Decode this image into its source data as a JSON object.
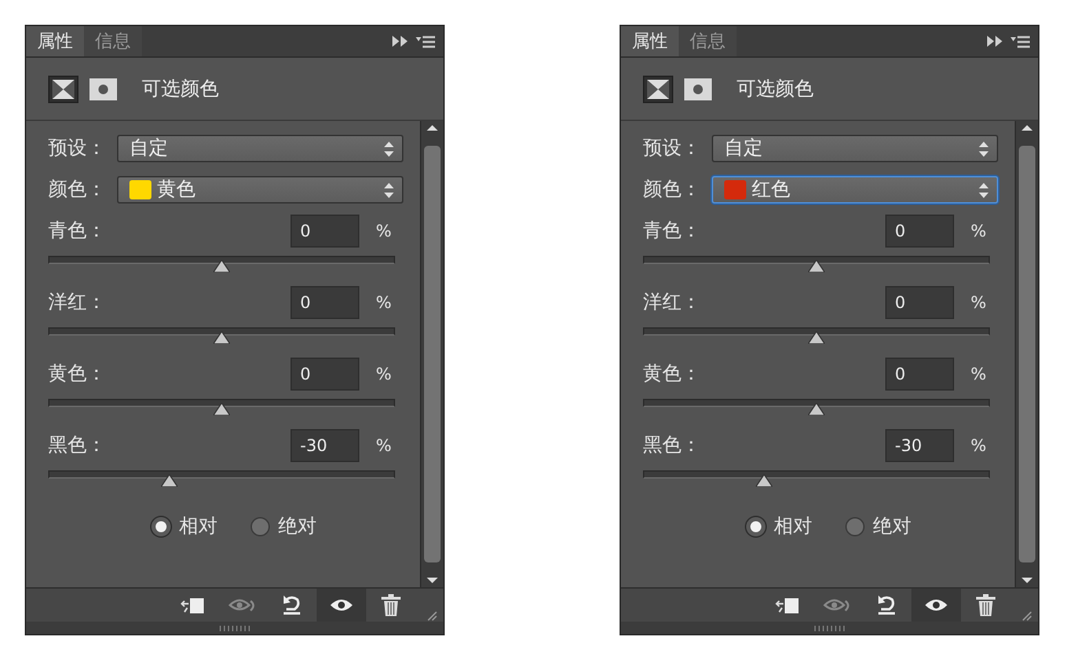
{
  "panels": [
    {
      "tabs": [
        {
          "label": "属性",
          "selected": true
        },
        {
          "label": "信息",
          "selected": false
        }
      ],
      "title": "可选颜色",
      "preset": {
        "label": "预设：",
        "value": "自定"
      },
      "color_field": {
        "label": "颜色：",
        "value": "黄色",
        "color": "#ffd800",
        "focused": false
      },
      "sliders": [
        {
          "name": "青色：",
          "value": "0",
          "unit": "%",
          "level": 0.5
        },
        {
          "name": "洋红：",
          "value": "0",
          "unit": "%",
          "level": 0.5
        },
        {
          "name": "黄色：",
          "value": "0",
          "unit": "%",
          "level": 0.5
        },
        {
          "name": "黑色：",
          "value": "-30",
          "unit": "%",
          "level": 0.35
        }
      ],
      "radios": [
        {
          "label": "相对",
          "selected": true
        },
        {
          "label": "绝对",
          "selected": false
        }
      ],
      "visibility_on": true
    },
    {
      "tabs": [
        {
          "label": "属性",
          "selected": true
        },
        {
          "label": "信息",
          "selected": false
        }
      ],
      "title": "可选颜色",
      "preset": {
        "label": "预设：",
        "value": "自定"
      },
      "color_field": {
        "label": "颜色：",
        "value": "红色",
        "color": "#d42a0c",
        "focused": true
      },
      "sliders": [
        {
          "name": "青色：",
          "value": "0",
          "unit": "%",
          "level": 0.5
        },
        {
          "name": "洋红：",
          "value": "0",
          "unit": "%",
          "level": 0.5
        },
        {
          "name": "黄色：",
          "value": "0",
          "unit": "%",
          "level": 0.5
        },
        {
          "name": "黑色：",
          "value": "-30",
          "unit": "%",
          "level": 0.35
        }
      ],
      "radios": [
        {
          "label": "相对",
          "selected": true
        },
        {
          "label": "绝对",
          "selected": false
        }
      ],
      "visibility_on": true
    }
  ]
}
